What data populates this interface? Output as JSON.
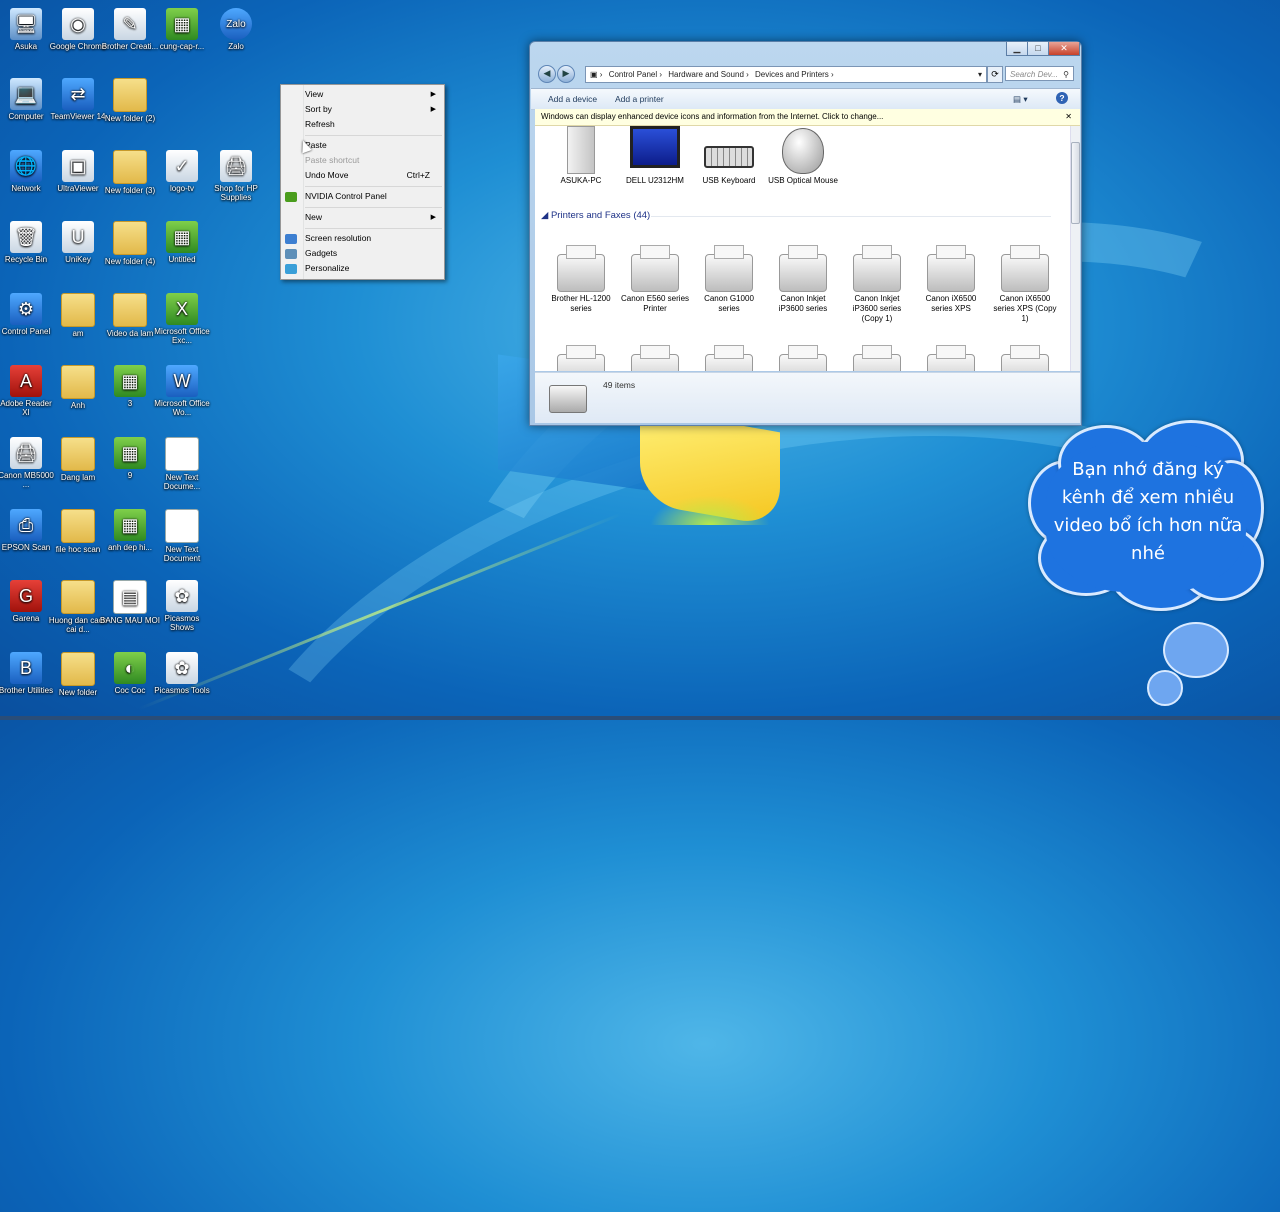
{
  "desktop_icons": [
    {
      "label": "Asuka",
      "icon": "monitor-icon"
    },
    {
      "label": "Google Chrome",
      "icon": "chrome-icon"
    },
    {
      "label": "Brother Creati...",
      "icon": "brother-icon"
    },
    {
      "label": "cung-cap-r...",
      "icon": "image-icon"
    },
    {
      "label": "Zalo",
      "icon": "zalo-icon"
    },
    {
      "label": "Computer",
      "icon": "computer-icon"
    },
    {
      "label": "TeamViewer 14",
      "icon": "teamviewer-icon"
    },
    {
      "label": "New folder (2)",
      "icon": "folder-icon"
    },
    {
      "label": "Network",
      "icon": "network-icon"
    },
    {
      "label": "UltraViewer",
      "icon": "ultraviewer-icon"
    },
    {
      "label": "New folder (3)",
      "icon": "folder-icon"
    },
    {
      "label": "logo-tv",
      "icon": "image-icon"
    },
    {
      "label": "Shop for HP Supplies",
      "icon": "hp-icon"
    },
    {
      "label": "Recycle Bin",
      "icon": "recycle-bin-icon"
    },
    {
      "label": "UniKey",
      "icon": "unikey-icon"
    },
    {
      "label": "New folder (4)",
      "icon": "folder-icon"
    },
    {
      "label": "Untitled",
      "icon": "image-icon"
    },
    {
      "label": "Control Panel",
      "icon": "control-panel-icon"
    },
    {
      "label": "am",
      "icon": "folder-icon"
    },
    {
      "label": "Video da lam",
      "icon": "folder-icon"
    },
    {
      "label": "Microsoft Office Exc...",
      "icon": "excel-icon"
    },
    {
      "label": "Adobe Reader XI",
      "icon": "adobe-icon"
    },
    {
      "label": "Anh",
      "icon": "folder-icon"
    },
    {
      "label": "3",
      "icon": "image-icon"
    },
    {
      "label": "Microsoft Office Wo...",
      "icon": "word-icon"
    },
    {
      "label": "Canon MB5000 ...",
      "icon": "canon-icon"
    },
    {
      "label": "Dang lam",
      "icon": "folder-icon"
    },
    {
      "label": "9",
      "icon": "image-icon"
    },
    {
      "label": "New Text Docume...",
      "icon": "text-document-icon"
    },
    {
      "label": "EPSON Scan",
      "icon": "epson-icon"
    },
    {
      "label": "file hoc scan",
      "icon": "folder-icon"
    },
    {
      "label": "anh dep hi...",
      "icon": "image-icon"
    },
    {
      "label": "New Text Document",
      "icon": "text-document-icon"
    },
    {
      "label": "Garena",
      "icon": "garena-icon"
    },
    {
      "label": "Huong dan cach cai d...",
      "icon": "folder-icon"
    },
    {
      "label": "BANG MAU MOI",
      "icon": "spreadsheet-icon"
    },
    {
      "label": "Picasmos Shows",
      "icon": "picasmos-icon"
    },
    {
      "label": "Brother Utilities",
      "icon": "brother-icon"
    },
    {
      "label": "New folder",
      "icon": "folder-icon"
    },
    {
      "label": "Coc Coc",
      "icon": "coccoc-icon"
    },
    {
      "label": "Picasmos Tools",
      "icon": "picasmos-icon"
    }
  ],
  "context_menu": {
    "view": "View",
    "sort_by": "Sort by",
    "refresh": "Refresh",
    "paste": "Paste",
    "paste_shortcut": "Paste shortcut",
    "undo_move": "Undo Move",
    "undo_shortcut": "Ctrl+Z",
    "nvidia": "NVIDIA Control Panel",
    "new": "New",
    "screen_resolution": "Screen resolution",
    "gadgets": "Gadgets",
    "personalize": "Personalize"
  },
  "explorer": {
    "breadcrumb": [
      "Control Panel",
      "Hardware and Sound",
      "Devices and Printers"
    ],
    "search_placeholder": "Search Dev...",
    "add_device": "Add a device",
    "add_printer": "Add a printer",
    "info_bar": "Windows can display enhanced device icons and information from the Internet. Click to change...",
    "devices": [
      "ASUKA-PC",
      "DELL U2312HM",
      "USB Keyboard",
      "USB Optical Mouse"
    ],
    "printers_header": "Printers and Faxes (44)",
    "printers": [
      "Brother HL-1200 series",
      "Canon E560 series Printer",
      "Canon G1000 series",
      "Canon Inkjet iP3600 series",
      "Canon Inkjet iP3600 series (Copy 1)",
      "Canon iX6500 series XPS",
      "Canon iX6500 series XPS (Copy 1)"
    ],
    "item_count": "49 items"
  },
  "cloud_text": "Bạn nhớ đăng ký kênh để xem nhiều video bổ ích hơn nữa nhé"
}
